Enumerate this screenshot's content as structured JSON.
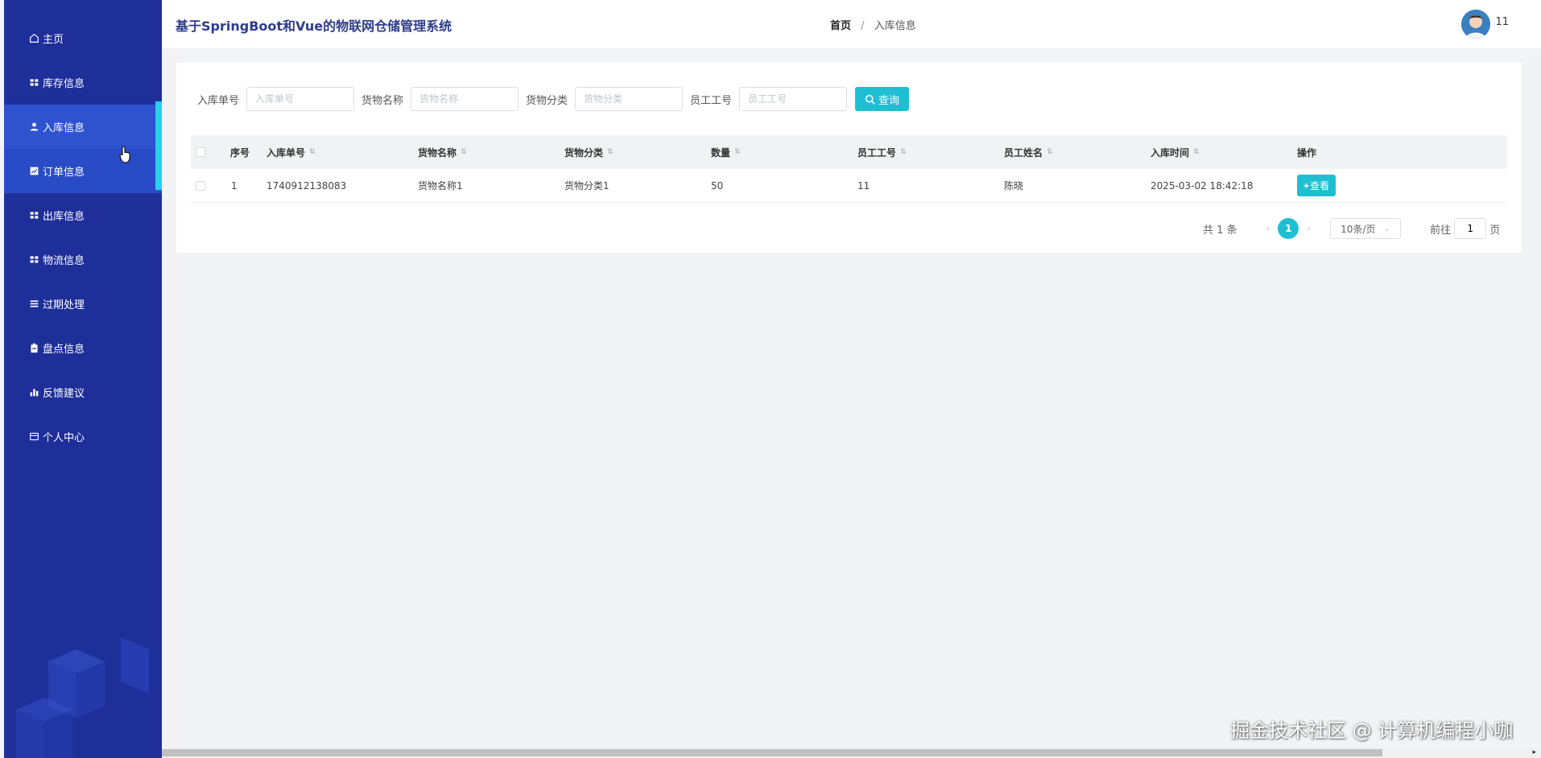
{
  "app_title": "基于SpringBoot和Vue的物联网仓储管理系统",
  "breadcrumb": {
    "home": "首页",
    "separator": "/",
    "current": "入库信息"
  },
  "user": {
    "name": "11"
  },
  "sidebar": {
    "items": [
      {
        "label": "主页",
        "icon": "home-icon"
      },
      {
        "label": "库存信息",
        "icon": "grid-icon"
      },
      {
        "label": "入库信息",
        "icon": "user-icon"
      },
      {
        "label": "订单信息",
        "icon": "chart-icon"
      },
      {
        "label": "出库信息",
        "icon": "grid-icon"
      },
      {
        "label": "物流信息",
        "icon": "grid-icon"
      },
      {
        "label": "过期处理",
        "icon": "list-icon"
      },
      {
        "label": "盘点信息",
        "icon": "clipboard-icon"
      },
      {
        "label": "反馈建议",
        "icon": "bar-chart-icon"
      },
      {
        "label": "个人中心",
        "icon": "card-icon"
      }
    ],
    "accent_color": "#27d1e8",
    "bg_color": "#1e2f9a"
  },
  "search": {
    "fields": [
      {
        "label": "入库单号",
        "placeholder": "入库单号"
      },
      {
        "label": "货物名称",
        "placeholder": "货物名称"
      },
      {
        "label": "货物分类",
        "placeholder": "货物分类"
      },
      {
        "label": "员工工号",
        "placeholder": "员工工号"
      }
    ],
    "button_label": "查询"
  },
  "table": {
    "headers": [
      "序号",
      "入库单号",
      "货物名称",
      "货物分类",
      "数量",
      "员工工号",
      "员工姓名",
      "入库时间",
      "操作"
    ],
    "rows": [
      {
        "index": "1",
        "order_no": "1740912138083",
        "goods_name": "货物名称1",
        "goods_category": "货物分类1",
        "quantity": "50",
        "employee_no": "11",
        "employee_name": "陈晓",
        "time": "2025-03-02 18:42:18",
        "action": "查看"
      }
    ]
  },
  "pagination": {
    "total": "共 1 条",
    "current_page": "1",
    "page_size": "10条/页",
    "goto_label": "前往",
    "goto_value": "1",
    "page_unit": "页"
  },
  "watermark": "掘金技术社区 @ 计算机编程小咖"
}
